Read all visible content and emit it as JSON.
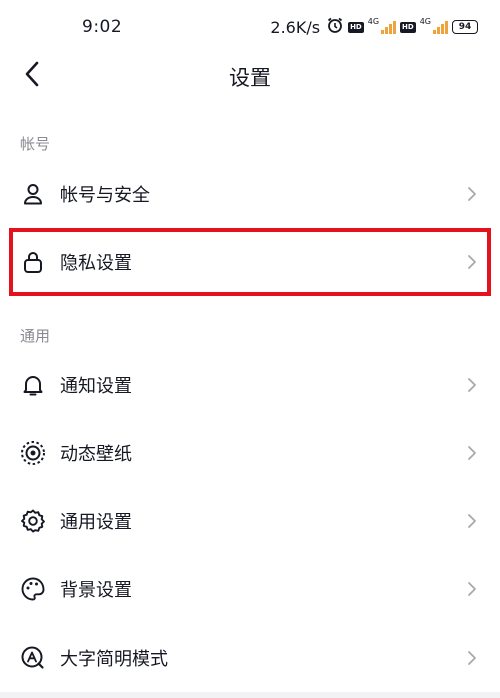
{
  "status_bar": {
    "time": "9:02",
    "net_speed": "2.6K/s",
    "hd_label": "HD",
    "net_type": "4G",
    "battery": "94"
  },
  "nav": {
    "title": "设置"
  },
  "sections": {
    "account_label": "帐号",
    "general_label": "通用"
  },
  "rows": {
    "account_security": "帐号与安全",
    "privacy": "隐私设置",
    "notification": "通知设置",
    "wallpaper": "动态壁纸",
    "general": "通用设置",
    "background": "背景设置",
    "large_text": "大字简明模式"
  },
  "colors": {
    "highlight": "#e3121c",
    "text": "#161823",
    "secondary_text": "#8a8b91"
  }
}
